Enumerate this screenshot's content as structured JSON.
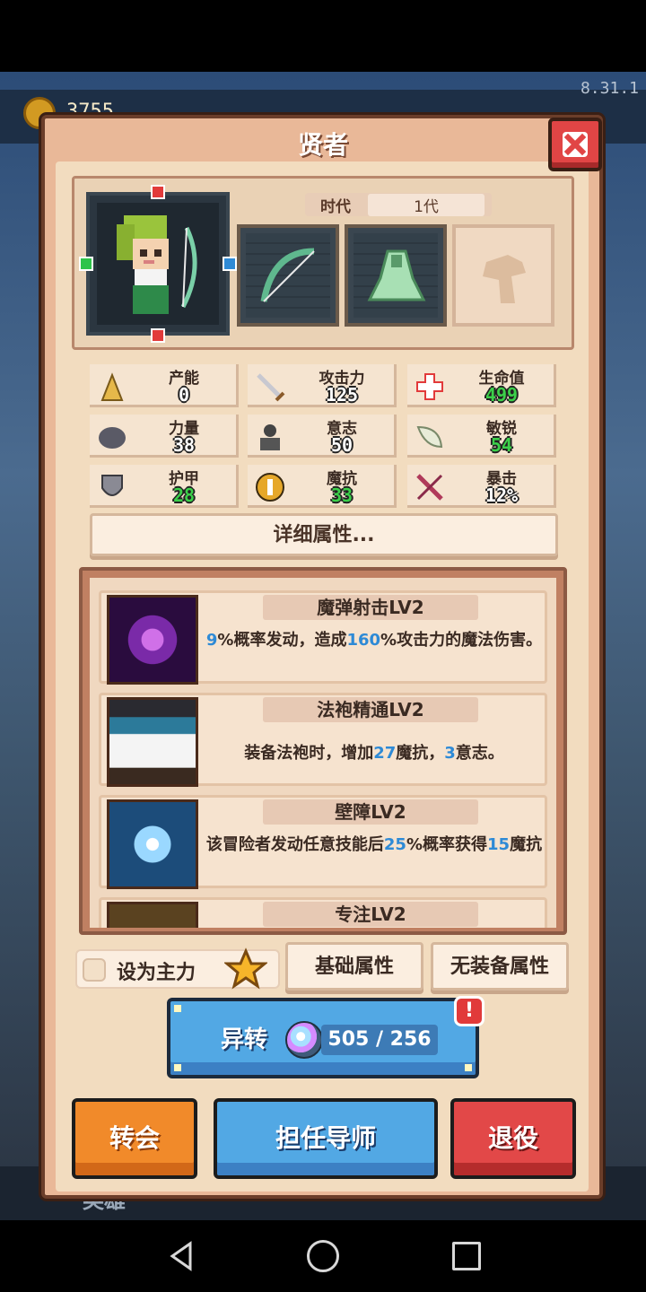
{
  "app": {
    "version": "8.31.1",
    "coins": "3755"
  },
  "dialog": {
    "title": "贤者"
  },
  "hero": {
    "era_label": "时代",
    "era_value": "1代"
  },
  "stats": [
    {
      "icon": "production-icon",
      "label": "产能",
      "value": "0",
      "green": false
    },
    {
      "icon": "sword-icon",
      "label": "攻击力",
      "value": "125",
      "green": false
    },
    {
      "icon": "health-cross-icon",
      "label": "生命值",
      "value": "499",
      "green": true
    },
    {
      "icon": "strength-icon",
      "label": "力量",
      "value": "38",
      "green": false
    },
    {
      "icon": "will-icon",
      "label": "意志",
      "value": "50",
      "green": false
    },
    {
      "icon": "agility-wing-icon",
      "label": "敏锐",
      "value": "54",
      "green": true
    },
    {
      "icon": "armor-shield-icon",
      "label": "护甲",
      "value": "28",
      "green": true
    },
    {
      "icon": "magic-resist-icon",
      "label": "魔抗",
      "value": "33",
      "green": true
    },
    {
      "icon": "critical-icon",
      "label": "暴击",
      "value": "12%",
      "green": false
    }
  ],
  "detail_button": "详细属性...",
  "skills": [
    {
      "name": "魔弹射击LV2",
      "desc_parts": [
        "9",
        "%概率发动，造成",
        "160",
        "%攻击力的魔法伤害。"
      ]
    },
    {
      "name": "法袍精通LV2",
      "desc_parts": [
        "装备法袍时，增加",
        "27",
        "魔抗，",
        "3",
        "意志。"
      ]
    },
    {
      "name": "壁障LV2",
      "desc_parts": [
        "该冒险者发动任意技能后",
        "25",
        "%概率获得",
        "15",
        "魔抗"
      ]
    },
    {
      "name": "专注LV2"
    }
  ],
  "controls": {
    "set_main": "设为主力",
    "base_attr": "基础属性",
    "no_equip_attr": "无装备属性",
    "reform_label": "异转",
    "reform_count": "505 / 256",
    "alert": "!",
    "rebirth": "转会",
    "mentor": "担任导师",
    "retire": "退役"
  },
  "background": {
    "bottom_tab": "英雄"
  }
}
